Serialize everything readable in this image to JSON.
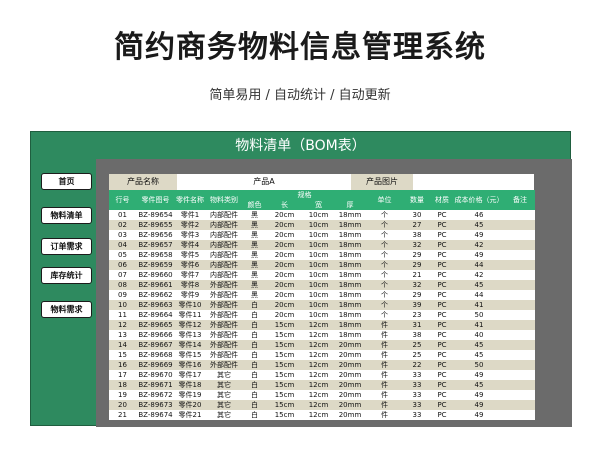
{
  "page": {
    "title": "简约商务物料信息管理系统",
    "subtitle": "简单易用  /  自动统计  /  自动更新"
  },
  "sheet": {
    "title": "物料清单（BOM表）",
    "nav": [
      "首页",
      "物料清单",
      "订单需求",
      "库存统计",
      "物料需求"
    ],
    "product_name_label": "产品名称",
    "product_name_value": "产品A",
    "product_image_label": "产品图片"
  },
  "table": {
    "spec_group": "规格",
    "headers": [
      "行号",
      "零件图号",
      "零件名称",
      "物料类别",
      "颜色",
      "长",
      "宽",
      "厚",
      "单位",
      "数量",
      "材质",
      "成本价格（元）",
      "备注"
    ],
    "rows": [
      [
        "01",
        "BZ-89654",
        "零件1",
        "内部配件",
        "黑",
        "20cm",
        "10cm",
        "18mm",
        "个",
        "30",
        "PC",
        "46",
        ""
      ],
      [
        "02",
        "BZ-89655",
        "零件2",
        "内部配件",
        "黑",
        "20cm",
        "10cm",
        "18mm",
        "个",
        "27",
        "PC",
        "45",
        ""
      ],
      [
        "03",
        "BZ-89656",
        "零件3",
        "内部配件",
        "黑",
        "20cm",
        "10cm",
        "18mm",
        "个",
        "38",
        "PC",
        "49",
        ""
      ],
      [
        "04",
        "BZ-89657",
        "零件4",
        "内部配件",
        "黑",
        "20cm",
        "10cm",
        "18mm",
        "个",
        "32",
        "PC",
        "42",
        ""
      ],
      [
        "05",
        "BZ-89658",
        "零件5",
        "内部配件",
        "黑",
        "20cm",
        "10cm",
        "18mm",
        "个",
        "29",
        "PC",
        "49",
        ""
      ],
      [
        "06",
        "BZ-89659",
        "零件6",
        "内部配件",
        "黑",
        "20cm",
        "10cm",
        "18mm",
        "个",
        "29",
        "PC",
        "44",
        ""
      ],
      [
        "07",
        "BZ-89660",
        "零件7",
        "内部配件",
        "黑",
        "20cm",
        "10cm",
        "18mm",
        "个",
        "21",
        "PC",
        "42",
        ""
      ],
      [
        "08",
        "BZ-89661",
        "零件8",
        "外部配件",
        "黑",
        "20cm",
        "10cm",
        "18mm",
        "个",
        "32",
        "PC",
        "45",
        ""
      ],
      [
        "09",
        "BZ-89662",
        "零件9",
        "外部配件",
        "黑",
        "20cm",
        "10cm",
        "18mm",
        "个",
        "29",
        "PC",
        "44",
        ""
      ],
      [
        "10",
        "BZ-89663",
        "零件10",
        "外部配件",
        "白",
        "20cm",
        "10cm",
        "18mm",
        "个",
        "39",
        "PC",
        "41",
        ""
      ],
      [
        "11",
        "BZ-89664",
        "零件11",
        "外部配件",
        "白",
        "20cm",
        "10cm",
        "18mm",
        "个",
        "23",
        "PC",
        "50",
        ""
      ],
      [
        "12",
        "BZ-89665",
        "零件12",
        "外部配件",
        "白",
        "15cm",
        "12cm",
        "18mm",
        "件",
        "31",
        "PC",
        "41",
        ""
      ],
      [
        "13",
        "BZ-89666",
        "零件13",
        "外部配件",
        "白",
        "15cm",
        "12cm",
        "18mm",
        "件",
        "38",
        "PC",
        "40",
        ""
      ],
      [
        "14",
        "BZ-89667",
        "零件14",
        "外部配件",
        "白",
        "15cm",
        "12cm",
        "20mm",
        "件",
        "25",
        "PC",
        "45",
        ""
      ],
      [
        "15",
        "BZ-89668",
        "零件15",
        "外部配件",
        "白",
        "15cm",
        "12cm",
        "20mm",
        "件",
        "25",
        "PC",
        "45",
        ""
      ],
      [
        "16",
        "BZ-89669",
        "零件16",
        "外部配件",
        "白",
        "15cm",
        "12cm",
        "20mm",
        "件",
        "22",
        "PC",
        "50",
        ""
      ],
      [
        "17",
        "BZ-89670",
        "零件17",
        "其它",
        "白",
        "15cm",
        "12cm",
        "20mm",
        "件",
        "33",
        "PC",
        "49",
        ""
      ],
      [
        "18",
        "BZ-89671",
        "零件18",
        "其它",
        "白",
        "15cm",
        "12cm",
        "20mm",
        "件",
        "33",
        "PC",
        "45",
        ""
      ],
      [
        "19",
        "BZ-89672",
        "零件19",
        "其它",
        "白",
        "15cm",
        "12cm",
        "20mm",
        "件",
        "33",
        "PC",
        "49",
        ""
      ],
      [
        "20",
        "BZ-89673",
        "零件20",
        "其它",
        "白",
        "15cm",
        "12cm",
        "20mm",
        "件",
        "33",
        "PC",
        "49",
        ""
      ],
      [
        "21",
        "BZ-89674",
        "零件21",
        "其它",
        "白",
        "15cm",
        "12cm",
        "20mm",
        "件",
        "33",
        "PC",
        "49",
        ""
      ]
    ]
  }
}
